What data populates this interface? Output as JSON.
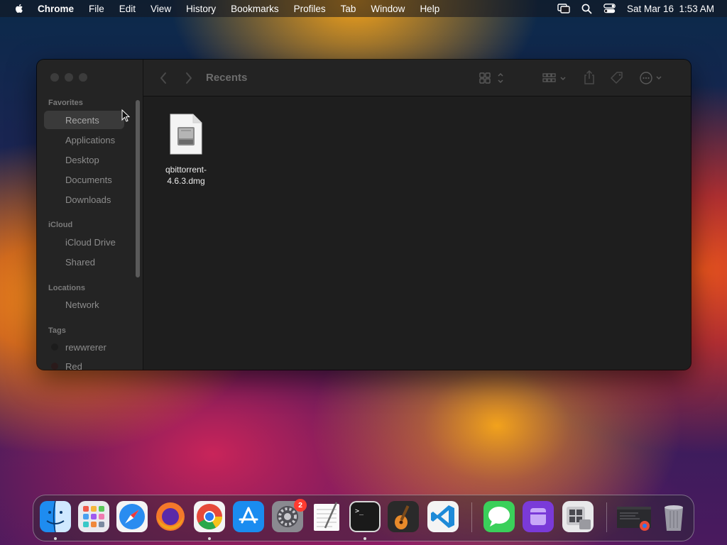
{
  "menubar": {
    "app_name": "Chrome",
    "items": [
      "File",
      "Edit",
      "View",
      "History",
      "Bookmarks",
      "Profiles",
      "Tab",
      "Window",
      "Help"
    ],
    "clock": "Sat Mar 16  1:53 AM"
  },
  "finder": {
    "title": "Recents",
    "sidebar": {
      "favorites_header": "Favorites",
      "favorites": [
        "Recents",
        "Applications",
        "Desktop",
        "Documents",
        "Downloads"
      ],
      "icloud_header": "iCloud",
      "icloud": [
        "iCloud Drive",
        "Shared"
      ],
      "locations_header": "Locations",
      "locations": [
        "Network"
      ],
      "tags_header": "Tags",
      "tags": [
        "rewwrerer",
        "Red"
      ]
    },
    "files": [
      {
        "name": "qbittorrent-4.6.3.dmg",
        "icon": "disk-image-icon"
      }
    ]
  },
  "dock": {
    "apps": [
      "finder",
      "launchpad",
      "safari",
      "firefox",
      "chrome",
      "app-store",
      "system-settings",
      "textedit",
      "terminal",
      "garageband",
      "vscode",
      "messages",
      "setapp",
      "boot-camp",
      "chrome-window",
      "trash"
    ],
    "settings_badge": "2"
  },
  "colors": {
    "window_bg": "#1e1e1e",
    "sidebar_bg": "#242424",
    "selection": "#3a3a3a",
    "badge": "#ff3b30"
  }
}
